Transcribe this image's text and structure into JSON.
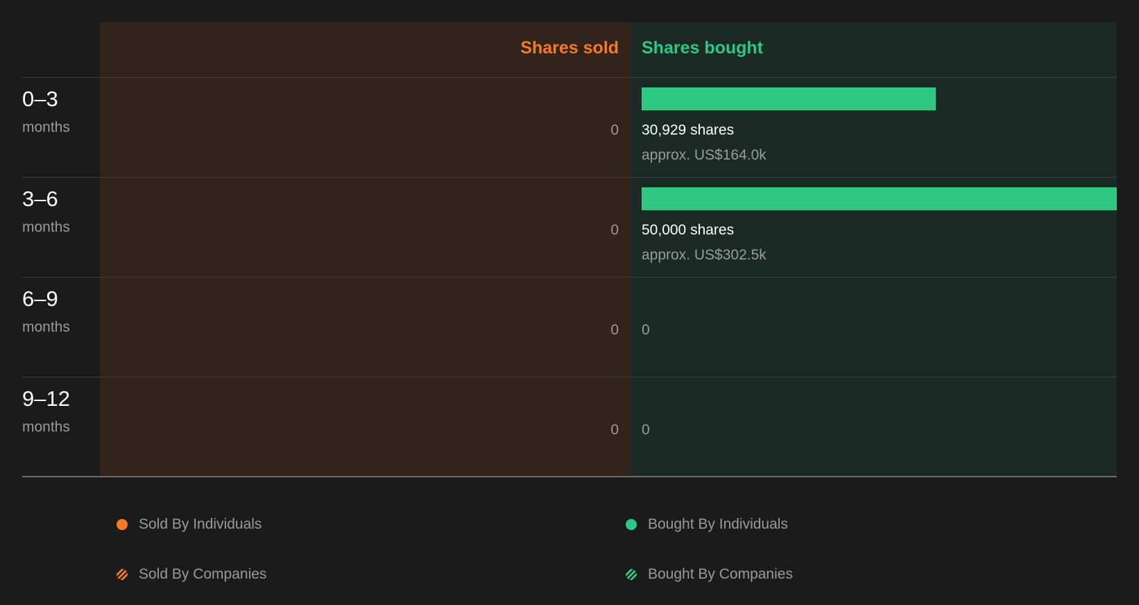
{
  "chart_data": {
    "type": "bar",
    "categories": [
      {
        "period": "0–3",
        "unit": "months"
      },
      {
        "period": "3–6",
        "unit": "months"
      },
      {
        "period": "6–9",
        "unit": "months"
      },
      {
        "period": "9–12",
        "unit": "months"
      }
    ],
    "sold_header": "Shares sold",
    "bought_header": "Shares bought",
    "series": [
      {
        "name": "Shares sold",
        "values": [
          0,
          0,
          0,
          0
        ],
        "labels": [
          "0",
          "0",
          "0",
          "0"
        ]
      },
      {
        "name": "Shares bought",
        "values": [
          30929,
          50000,
          0,
          0
        ],
        "labels": [
          "30,929 shares",
          "50,000 shares",
          "0",
          "0"
        ],
        "approx": [
          "approx. US$164.0k",
          "approx. US$302.5k",
          "",
          ""
        ]
      }
    ],
    "bought_max": 50000,
    "legend": [
      {
        "label": "Sold By Individuals",
        "style": "dot",
        "color": "#f47a24"
      },
      {
        "label": "Bought By Individuals",
        "style": "dot",
        "color": "#2ec880"
      },
      {
        "label": "Sold By Companies",
        "style": "hatch",
        "color": "#f47a24"
      },
      {
        "label": "Bought By Companies",
        "style": "hatch",
        "color": "#2ec880"
      }
    ],
    "colors": {
      "sold": "#f47a24",
      "bought": "#2ec880",
      "sold_bg": "#32231c",
      "bought_bg": "#1c2a25"
    }
  }
}
